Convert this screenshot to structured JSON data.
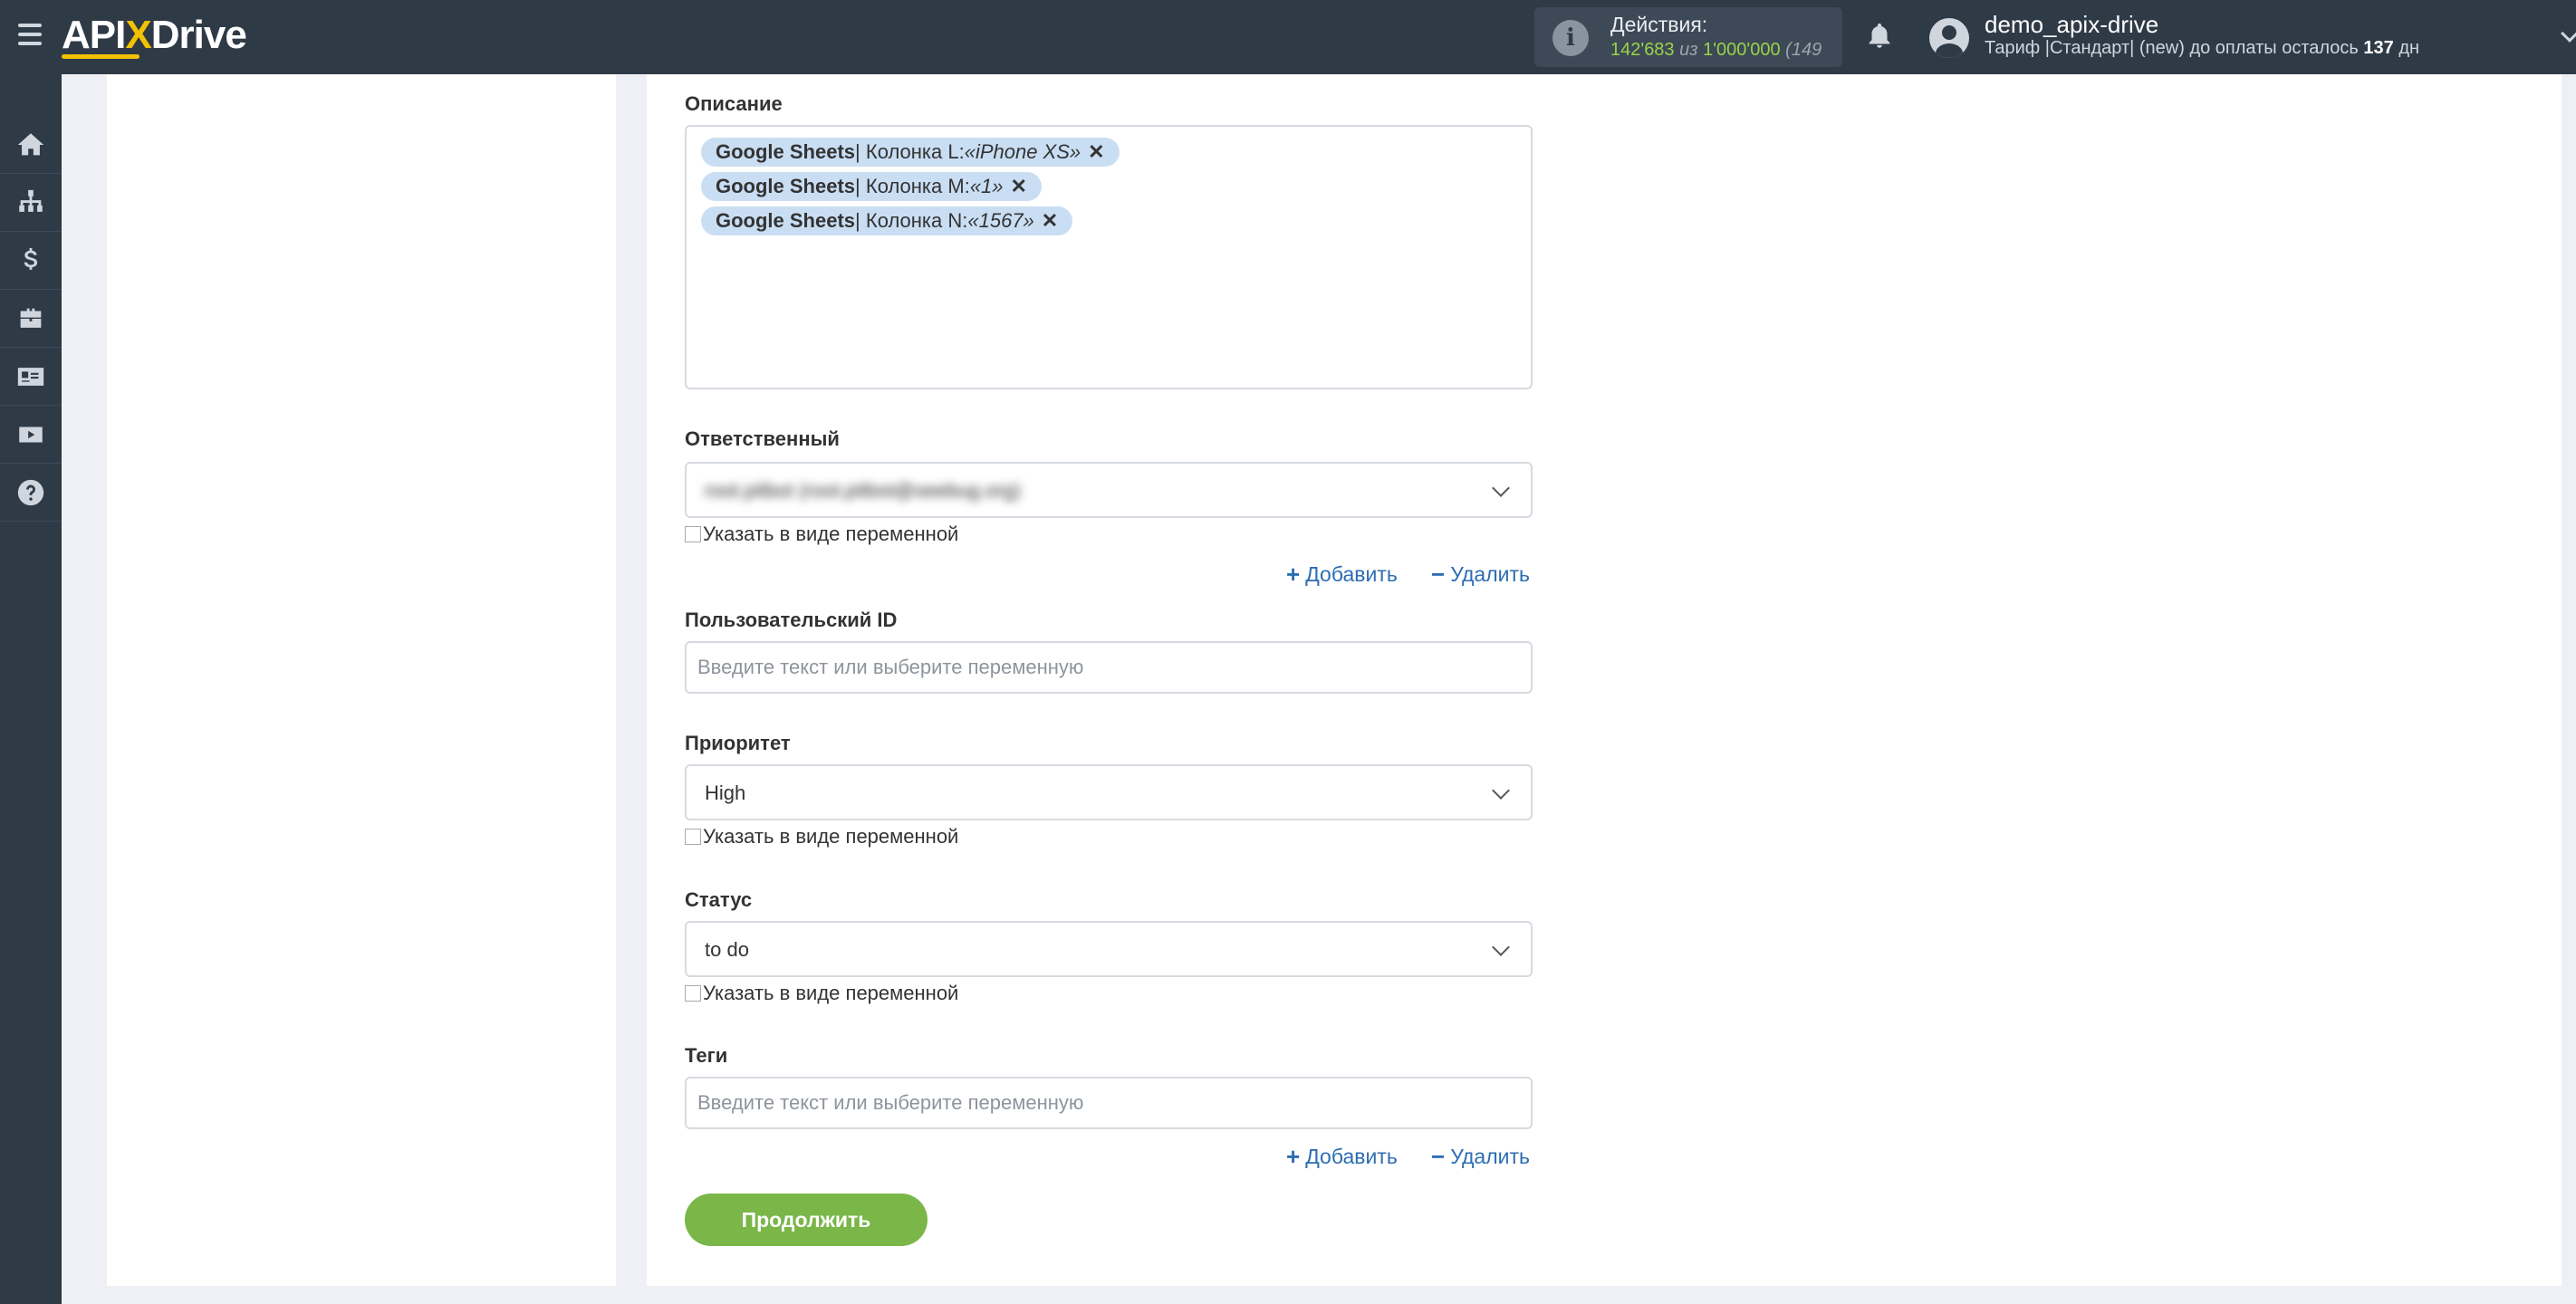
{
  "header": {
    "logo": {
      "prefix": "API",
      "x": "X",
      "suffix": "Drive"
    },
    "actions": {
      "title": "Действия:",
      "used": "142'683",
      "separator": "из",
      "total": "1'000'000",
      "extra": "(149"
    },
    "user": {
      "name": "demo_apix-drive",
      "tariff_prefix": "Тариф |Стандарт| (new) до оплаты осталось",
      "days": "137",
      "days_suffix": "дн"
    }
  },
  "sidebar": {
    "items": [
      {
        "icon": "home-icon"
      },
      {
        "icon": "sitemap-icon"
      },
      {
        "icon": "dollar-icon"
      },
      {
        "icon": "briefcase-icon"
      },
      {
        "icon": "contact-card-icon"
      },
      {
        "icon": "youtube-icon"
      },
      {
        "icon": "help-icon"
      }
    ]
  },
  "form": {
    "description": {
      "label": "Описание",
      "chips": [
        {
          "source": "Google Sheets",
          "column": " | Колонка L: ",
          "value": "«iPhone XS»"
        },
        {
          "source": "Google Sheets",
          "column": " | Колонка M: ",
          "value": "«1»"
        },
        {
          "source": "Google Sheets",
          "column": " | Колонка N: ",
          "value": "«1567»"
        }
      ]
    },
    "assignee": {
      "label": "Ответственный",
      "value": "root.pitbot (root.pitbot@seebug.org)",
      "checkbox_label": "Указать в виде переменной",
      "add_label": "Добавить",
      "remove_label": "Удалить"
    },
    "user_id": {
      "label": "Пользовательский ID",
      "placeholder": "Введите текст или выберите переменную"
    },
    "priority": {
      "label": "Приоритет",
      "value": "High",
      "checkbox_label": "Указать в виде переменной"
    },
    "status": {
      "label": "Статус",
      "value": "to do",
      "checkbox_label": "Указать в виде переменной"
    },
    "tags": {
      "label": "Теги",
      "placeholder": "Введите текст или выберите переменную",
      "add_label": "Добавить",
      "remove_label": "Удалить"
    },
    "continue_label": "Продолжить"
  },
  "colors": {
    "topbar": "#2f3a47",
    "accent_green": "#7ab648",
    "link_blue": "#2c6db2",
    "chip_bg": "#c9def3",
    "logo_yellow": "#f2c200"
  }
}
